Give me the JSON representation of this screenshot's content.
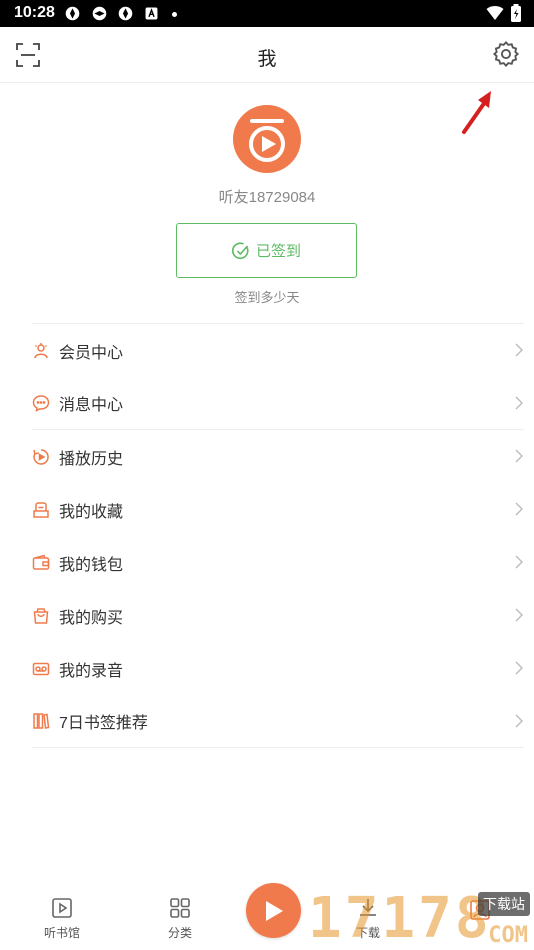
{
  "status_bar": {
    "time": "10:28"
  },
  "header": {
    "title": "我"
  },
  "profile": {
    "nickname": "听友18729084",
    "sign_button": "已签到",
    "sign_subtitle": "签到多少天"
  },
  "menu": [
    {
      "label": "会员中心",
      "icon": "vip-icon"
    },
    {
      "label": "消息中心",
      "icon": "message-icon"
    },
    {
      "label": "播放历史",
      "icon": "history-icon"
    },
    {
      "label": "我的收藏",
      "icon": "favorites-icon"
    },
    {
      "label": "我的钱包",
      "icon": "wallet-icon"
    },
    {
      "label": "我的购买",
      "icon": "purchase-icon"
    },
    {
      "label": "我的录音",
      "icon": "recording-icon"
    },
    {
      "label": "7日书签推荐",
      "icon": "bookmark-icon"
    }
  ],
  "bottom_nav": {
    "library": "听书馆",
    "category": "分类",
    "download": "下载"
  },
  "watermark": {
    "digits": "17178",
    "badge": "下载站",
    "suffix": "COM"
  },
  "colors": {
    "accent": "#f07a4b",
    "sign_green": "#5dbb63",
    "text": "#333333",
    "muted": "#888888"
  }
}
